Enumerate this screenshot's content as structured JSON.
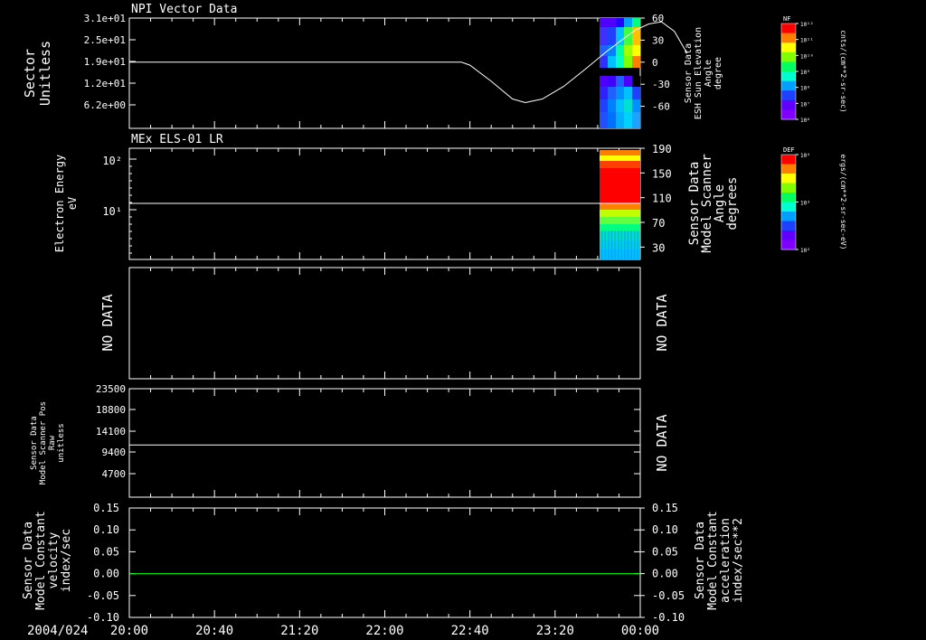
{
  "colors": {
    "background": "#000000",
    "foreground": "#ffffff",
    "accent_green": "#00ff00"
  },
  "time_axis": {
    "date_label": "2004/024",
    "ticks": [
      "20:00",
      "20:40",
      "21:20",
      "22:00",
      "22:40",
      "23:20",
      "00:00"
    ]
  },
  "chart_data": [
    {
      "type": "line",
      "title": "NPI Vector Data",
      "ylabel": [
        "Sector",
        "Unitless"
      ],
      "yticks": [
        "3.1e+01",
        "2.5e+01",
        "1.9e+01",
        "1.2e+01",
        "6.2e+00"
      ],
      "right_axis": {
        "label": [
          "Sensor Data",
          "ESH Sun Elevation",
          "Angle",
          "degree"
        ],
        "ticks": [
          "60",
          "30",
          "0",
          "-30",
          "-60"
        ],
        "ylim": [
          -90,
          60
        ]
      },
      "series": [
        {
          "axis": "right",
          "x_minutes": [
            0,
            156,
            160,
            170,
            180,
            186,
            194,
            204,
            214,
            224,
            234,
            238,
            244,
            250,
            256,
            262
          ],
          "y": [
            0,
            0,
            -4,
            -26,
            -50,
            -55,
            -50,
            -33,
            -10,
            14,
            36,
            44,
            52,
            55,
            42,
            12
          ]
        }
      ],
      "spectrogram": {
        "colorbar_title": "NF",
        "colorbar_units": "cnts/(cm**2-sr-sec)",
        "colorbar_ticks": [
          "10¹²",
          "10¹¹",
          "10¹⁰",
          "10⁹",
          "10⁸",
          "10⁷",
          "10⁶"
        ]
      }
    },
    {
      "type": "heatmap",
      "title": "MEx ELS-01 LR",
      "ylabel": [
        "Electron Energy",
        "eV"
      ],
      "yticks": [
        "10²",
        "10¹"
      ],
      "right_axis": {
        "label": [
          "Sensor Data",
          "Model Scanner",
          "Angle",
          "degrees"
        ],
        "ticks": [
          "190",
          "150",
          "110",
          "70",
          "30"
        ],
        "ylim": [
          10,
          190
        ]
      },
      "series": [
        {
          "axis": "left",
          "value": "10¹"
        }
      ],
      "spectrogram": {
        "colorbar_title": "DEF",
        "colorbar_units": "ergs/(cm**2-sr-sec-eV)",
        "colorbar_ticks": [
          "10⁴",
          "10³",
          "10²"
        ]
      }
    },
    {
      "type": "line",
      "ylabel": "NO DATA",
      "right_label": "NO DATA"
    },
    {
      "type": "line",
      "ylabel": [
        "Sensor Data",
        "Model Scanner Pos",
        "Raw",
        "unitless"
      ],
      "yticks": [
        "23500",
        "18800",
        "14100",
        "9400",
        "4700"
      ],
      "ylim": [
        0,
        23500
      ],
      "right_label": "NO DATA",
      "series": [
        {
          "x_minutes": [
            0,
            240
          ],
          "y": [
            11300,
            11300
          ]
        }
      ]
    },
    {
      "type": "line",
      "ylabel": [
        "Sensor Data",
        "Model Constant",
        "velocity",
        "index/sec"
      ],
      "yticks": [
        "0.15",
        "0.10",
        "0.05",
        "0.00",
        "-0.05",
        "-0.10"
      ],
      "ylim": [
        -0.1,
        0.15
      ],
      "right_axis": {
        "label": [
          "Sensor Data",
          "Model Constant",
          "acceleration",
          "index/sec**2"
        ],
        "ticks": [
          "0.15",
          "0.10",
          "0.05",
          "0.00",
          "-0.05",
          "-0.10"
        ]
      },
      "series": [
        {
          "color": "#00ff00",
          "x_minutes": [
            0,
            240
          ],
          "y": [
            0,
            0
          ]
        }
      ]
    }
  ]
}
